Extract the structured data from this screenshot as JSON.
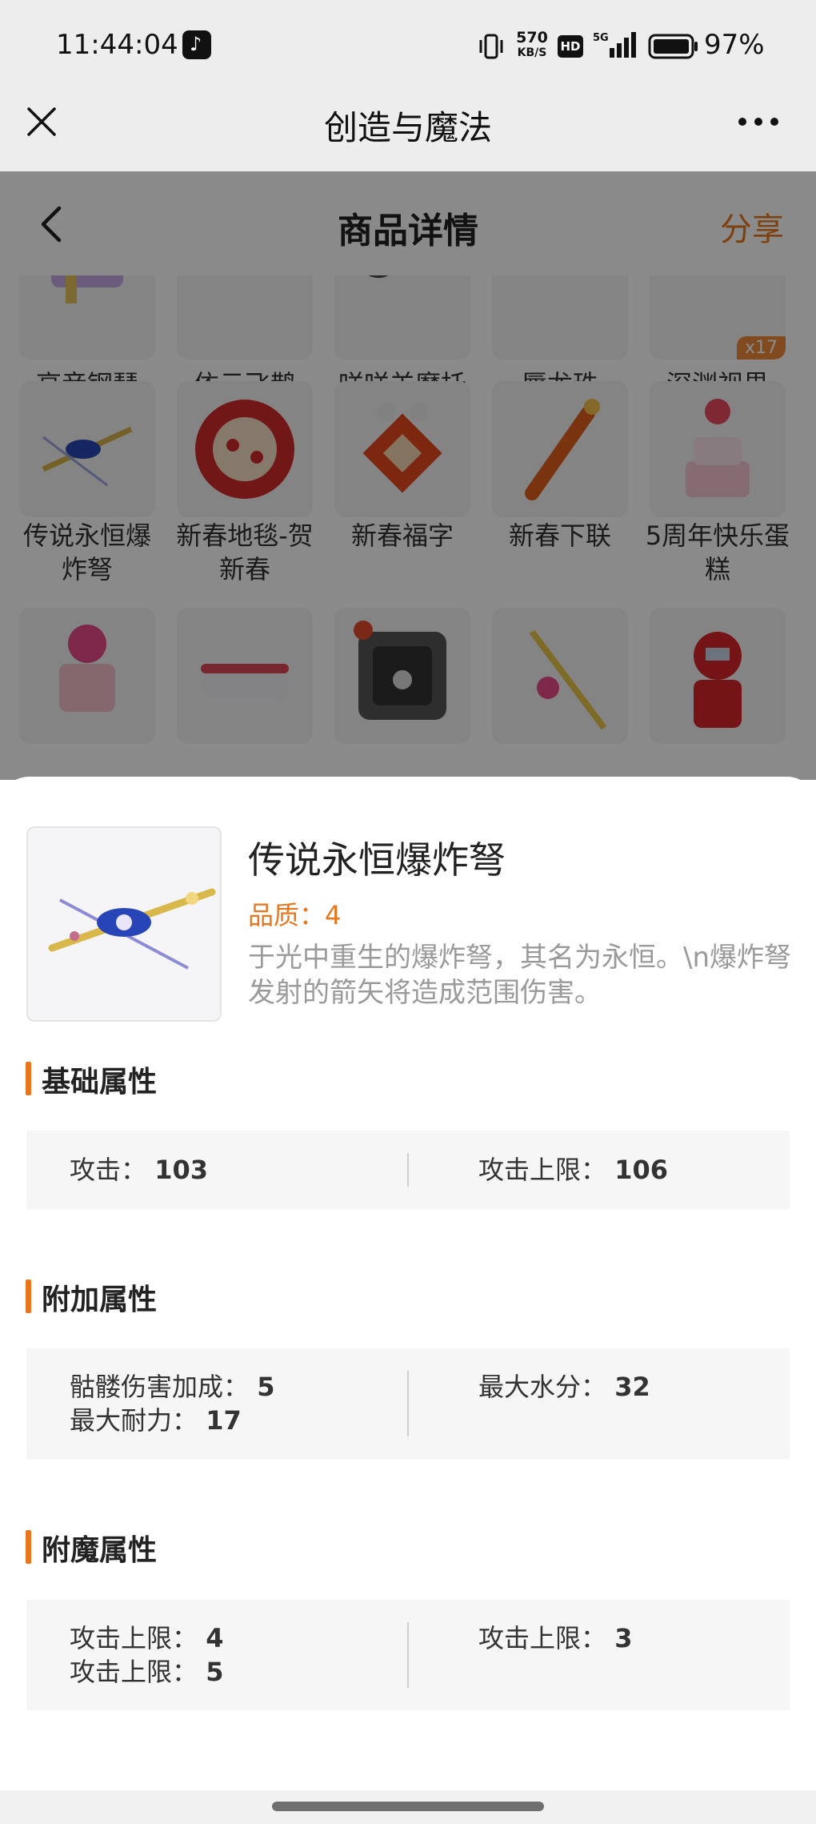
{
  "status_bar": {
    "time": "11:44:04",
    "app_icon": "tiktok-icon",
    "net_speed_value": "570",
    "net_speed_unit": "KB/S",
    "hd_label": "HD",
    "network": "5G",
    "battery_pct": "97%"
  },
  "title_bar": {
    "close_icon": "close-icon",
    "title": "创造与魔法",
    "more_icon": "more-dots-icon"
  },
  "page": {
    "header_title": "商品详情",
    "share_label": "分享",
    "grid_items": [
      {
        "label": "高音钢琴"
      },
      {
        "label": "依云飞鹊"
      },
      {
        "label": "咩咩羊摩托车"
      },
      {
        "label": "蜃龙珠"
      },
      {
        "label": "深渊视界",
        "badge": "x17"
      },
      {
        "label": "传说永恒爆炸弩"
      },
      {
        "label": "新春地毯-贺新春"
      },
      {
        "label": "新春福字"
      },
      {
        "label": "新春下联"
      },
      {
        "label": "5周年快乐蛋糕"
      },
      {
        "label": ""
      },
      {
        "label": ""
      },
      {
        "label": ""
      },
      {
        "label": ""
      },
      {
        "label": ""
      }
    ]
  },
  "detail": {
    "name": "传说永恒爆炸弩",
    "quality": "品质：4",
    "description": "于光中重生的爆炸弩，其名为永恒。\\n爆炸弩发射的箭矢将造成范围伤害。",
    "sections": {
      "basic": {
        "title": "基础属性",
        "left": [
          {
            "label": "攻击：",
            "value": "103"
          }
        ],
        "right": [
          {
            "label": "攻击上限：",
            "value": "106"
          }
        ]
      },
      "extra": {
        "title": "附加属性",
        "left": [
          {
            "label": "骷髅伤害加成：",
            "value": "5"
          },
          {
            "label": "最大耐力：",
            "value": "17"
          }
        ],
        "right": [
          {
            "label": "最大水分：",
            "value": "32"
          }
        ]
      },
      "enchant": {
        "title": "附魔属性",
        "left": [
          {
            "label": "攻击上限：",
            "value": "4"
          },
          {
            "label": "攻击上限：",
            "value": "5"
          }
        ],
        "right": [
          {
            "label": "攻击上限：",
            "value": "3"
          }
        ]
      }
    }
  },
  "colors": {
    "accent": "#e8761e",
    "overlay": "#000000"
  }
}
